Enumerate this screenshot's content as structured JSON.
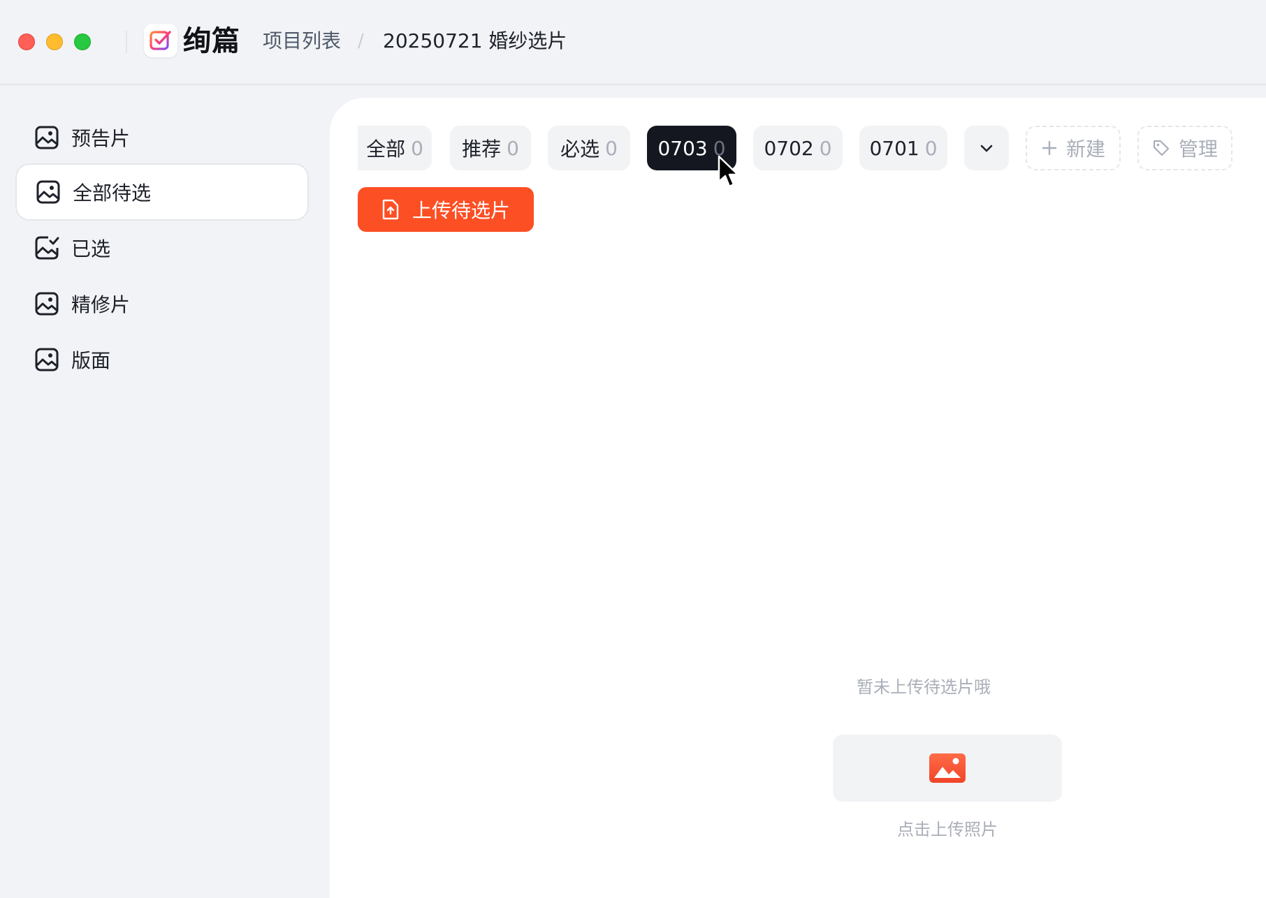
{
  "app": {
    "name": "绚篇",
    "breadcrumb": {
      "root": "项目列表",
      "separator": "/",
      "current": "20250721 婚纱选片"
    }
  },
  "sidebar": {
    "items": [
      {
        "label": "预告片",
        "icon": "image-icon"
      },
      {
        "label": "全部待选",
        "icon": "image-icon",
        "active": true
      },
      {
        "label": "已选",
        "icon": "image-check-icon"
      },
      {
        "label": "精修片",
        "icon": "image-icon"
      },
      {
        "label": "版面",
        "icon": "image-icon"
      }
    ]
  },
  "tabs": [
    {
      "label": "全部",
      "count": "0"
    },
    {
      "label": "推荐",
      "count": "0"
    },
    {
      "label": "必选",
      "count": "0"
    },
    {
      "label": "0703",
      "count": "0",
      "active": true
    },
    {
      "label": "0702",
      "count": "0"
    },
    {
      "label": "0701",
      "count": "0"
    }
  ],
  "toolbar": {
    "more_icon": "chevron-down-icon",
    "new_label": "新建",
    "manage_label": "管理",
    "upload_label": "上传待选片"
  },
  "empty": {
    "message": "暂未上传待选片哦",
    "upload_hint": "点击上传照片"
  },
  "colors": {
    "accent": "#fd4f24",
    "active_tab": "#14171f",
    "background": "#f2f3f6"
  }
}
